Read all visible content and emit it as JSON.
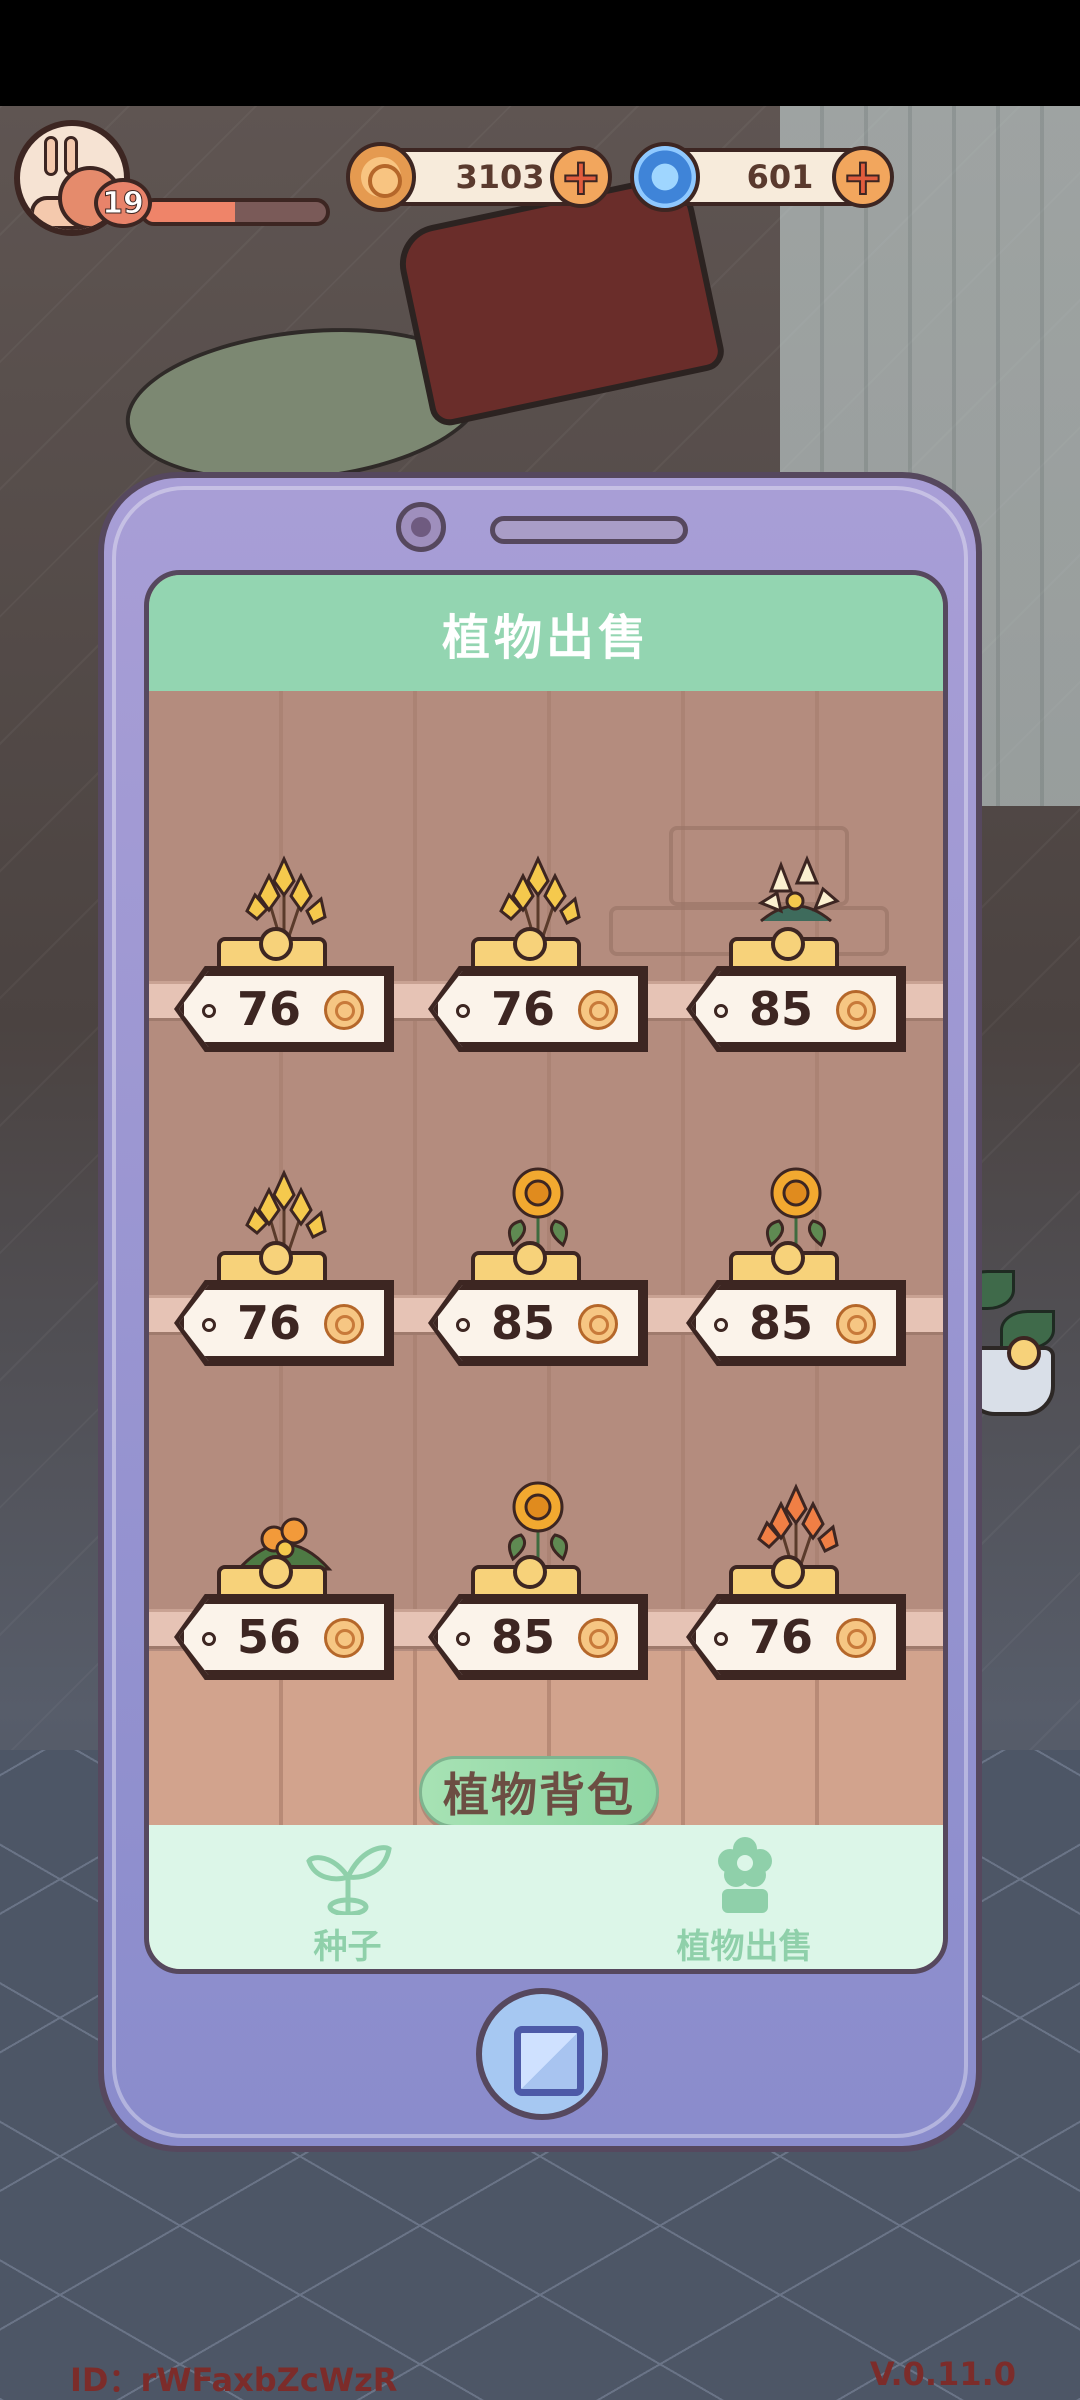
{
  "hud": {
    "level": "19",
    "xp_fraction": 0.5,
    "coins": "3103",
    "gems": "601"
  },
  "panel": {
    "title": "植物出售",
    "items": [
      {
        "price": "76",
        "flower": "yellow-lily"
      },
      {
        "price": "76",
        "flower": "yellow-lily"
      },
      {
        "price": "85",
        "flower": "white-star"
      },
      {
        "price": "76",
        "flower": "yellow-lily"
      },
      {
        "price": "85",
        "flower": "orange-marigold"
      },
      {
        "price": "85",
        "flower": "orange-marigold"
      },
      {
        "price": "56",
        "flower": "orange-daisy"
      },
      {
        "price": "85",
        "flower": "orange-marigold"
      },
      {
        "price": "76",
        "flower": "orange-lily"
      }
    ],
    "bag_button": "植物背包",
    "tabs": [
      {
        "label": "种子",
        "icon": "sprout-icon"
      },
      {
        "label": "植物出售",
        "icon": "flower-icon"
      }
    ]
  },
  "footer": {
    "id_text": "ID：rWFaxbZcWzR",
    "version": "V.0.11.0"
  },
  "colors": {
    "header_green": "#93d5b1",
    "phone_purple": "#a89ed6",
    "coin_orange": "#f2a65d"
  }
}
